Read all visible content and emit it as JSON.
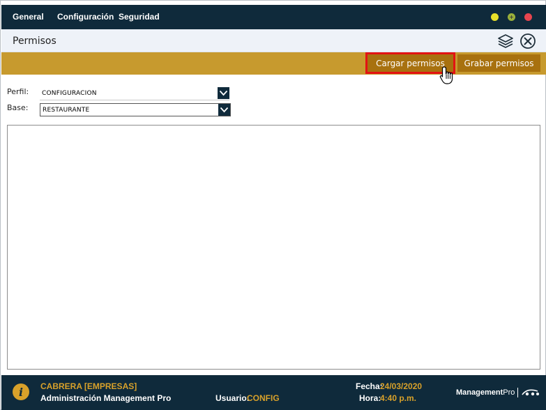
{
  "menu": {
    "items": [
      "General",
      "Configuración",
      "Seguridad"
    ]
  },
  "window_controls": {
    "minimize": "−",
    "maximize": "+",
    "close": "×",
    "colors": {
      "minimize": "#e8e02a",
      "maximize": "#9ab03a",
      "close": "#e8454f"
    }
  },
  "window": {
    "title": "Permisos"
  },
  "toolbar": {
    "load_label": "Cargar permisos",
    "save_label": "Grabar permisos"
  },
  "form": {
    "perfil_label": "Perfil:",
    "perfil_value": "CONFIGURACION",
    "base_label": "Base:",
    "base_value": "RESTAURANTE"
  },
  "status": {
    "company": "CABRERA [EMPRESAS]",
    "app_name": "Administración Management Pro",
    "user_label": "Usuario:",
    "user_value": "CONFIG",
    "date_label": "Fecha:",
    "date_value": "24/03/2020",
    "time_label": "Hora:",
    "time_value": "4:40 p.m.",
    "brand_bold": "Management",
    "brand_light": "Pro"
  },
  "colors": {
    "navy": "#0f2a3b",
    "gold": "#c79a2e",
    "button": "#a8710f",
    "highlight": "#e31313"
  }
}
